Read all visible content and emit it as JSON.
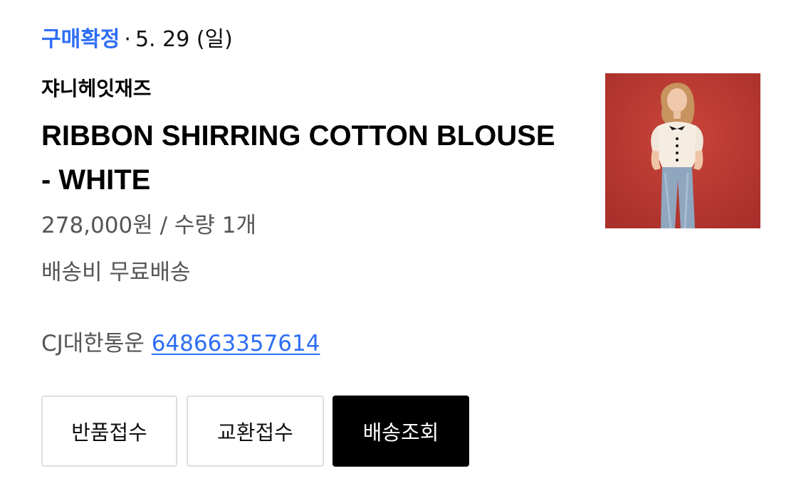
{
  "order": {
    "status_label": "구매확정",
    "separator": "·",
    "date": "5. 29 (일)",
    "brand": "쟈니헤잇재즈",
    "product_name": "RIBBON SHIRRING COTTON BLOUSE - WHITE",
    "price_quantity": "278,000원 / 수량 1개",
    "shipping_fee": "배송비 무료배송",
    "courier": "CJ대한통운",
    "tracking_number": "648663357614"
  },
  "actions": {
    "return_label": "반품접수",
    "exchange_label": "교환접수",
    "track_label": "배송조회"
  },
  "colors": {
    "status_accent": "#2e6ef5",
    "link": "#2e6ef5",
    "primary_button_bg": "#000000",
    "thumbnail_bg": "#bd3a30"
  }
}
